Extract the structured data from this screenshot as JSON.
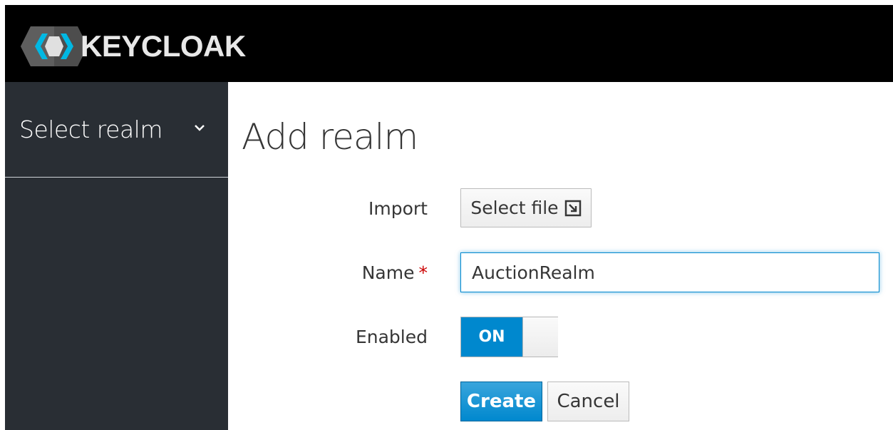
{
  "brand": {
    "name": "KEYCLOAK",
    "icon": "keycloak-logo-icon"
  },
  "sidebar": {
    "realm_select_label": "Select realm",
    "chevron_icon": "chevron-down-icon"
  },
  "main": {
    "title": "Add realm",
    "form": {
      "import_label": "Import",
      "select_file_label": "Select file",
      "select_file_icon": "import-icon",
      "name_label": "Name",
      "name_required_marker": "*",
      "name_value": "AuctionRealm",
      "enabled_label": "Enabled",
      "enabled_toggle_label": "ON",
      "enabled": true,
      "create_label": "Create",
      "cancel_label": "Cancel"
    }
  },
  "colors": {
    "topbar_bg": "#000000",
    "sidebar_bg": "#292e34",
    "accent": "#0088ce",
    "required": "#cc0000"
  }
}
